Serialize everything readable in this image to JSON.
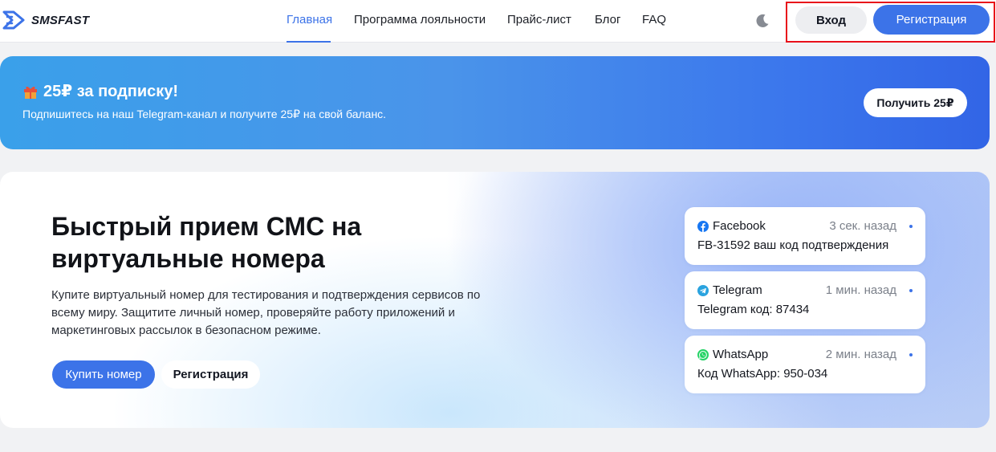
{
  "brand": {
    "name": "SMSFAST"
  },
  "nav": {
    "items": [
      {
        "label": "Главная",
        "active": true
      },
      {
        "label": "Программа лояльности"
      },
      {
        "label": "Прайс-лист"
      },
      {
        "label": "Блог"
      },
      {
        "label": "FAQ"
      }
    ]
  },
  "header": {
    "login_label": "Вход",
    "register_label": "Регистрация",
    "theme_icon": "moon-icon"
  },
  "promo": {
    "title": "25₽ за подписку!",
    "subtitle": "Подпишитесь на наш Telegram-канал и получите 25₽ на свой баланс.",
    "button_label": "Получить 25₽",
    "icon": "gift-icon"
  },
  "hero": {
    "title": "Быстрый прием СМС на виртуальные номера",
    "description": "Купите виртуальный номер для тестирования и подтверждения сервисов по всему миру. Защитите личный номер, проверяйте работу приложений и маркетинговых рассылок в безопасном режиме.",
    "buy_label": "Купить номер",
    "register_label": "Регистрация"
  },
  "messages": [
    {
      "app": "Facebook",
      "time": "3 сек. назад",
      "text": "FB-31592 ваш код подтверждения",
      "icon": "facebook-icon",
      "color": "#1877f2"
    },
    {
      "app": "Telegram",
      "time": "1 мин. назад",
      "text": "Telegram код: 87434",
      "icon": "telegram-icon",
      "color": "#2aa3df"
    },
    {
      "app": "WhatsApp",
      "time": "2 мин. назад",
      "text": "Код WhatsApp: 950-034",
      "icon": "whatsapp-icon",
      "color": "#25d366"
    }
  ],
  "colors": {
    "accent": "#3c73e8",
    "highlight": "#e8101a"
  }
}
